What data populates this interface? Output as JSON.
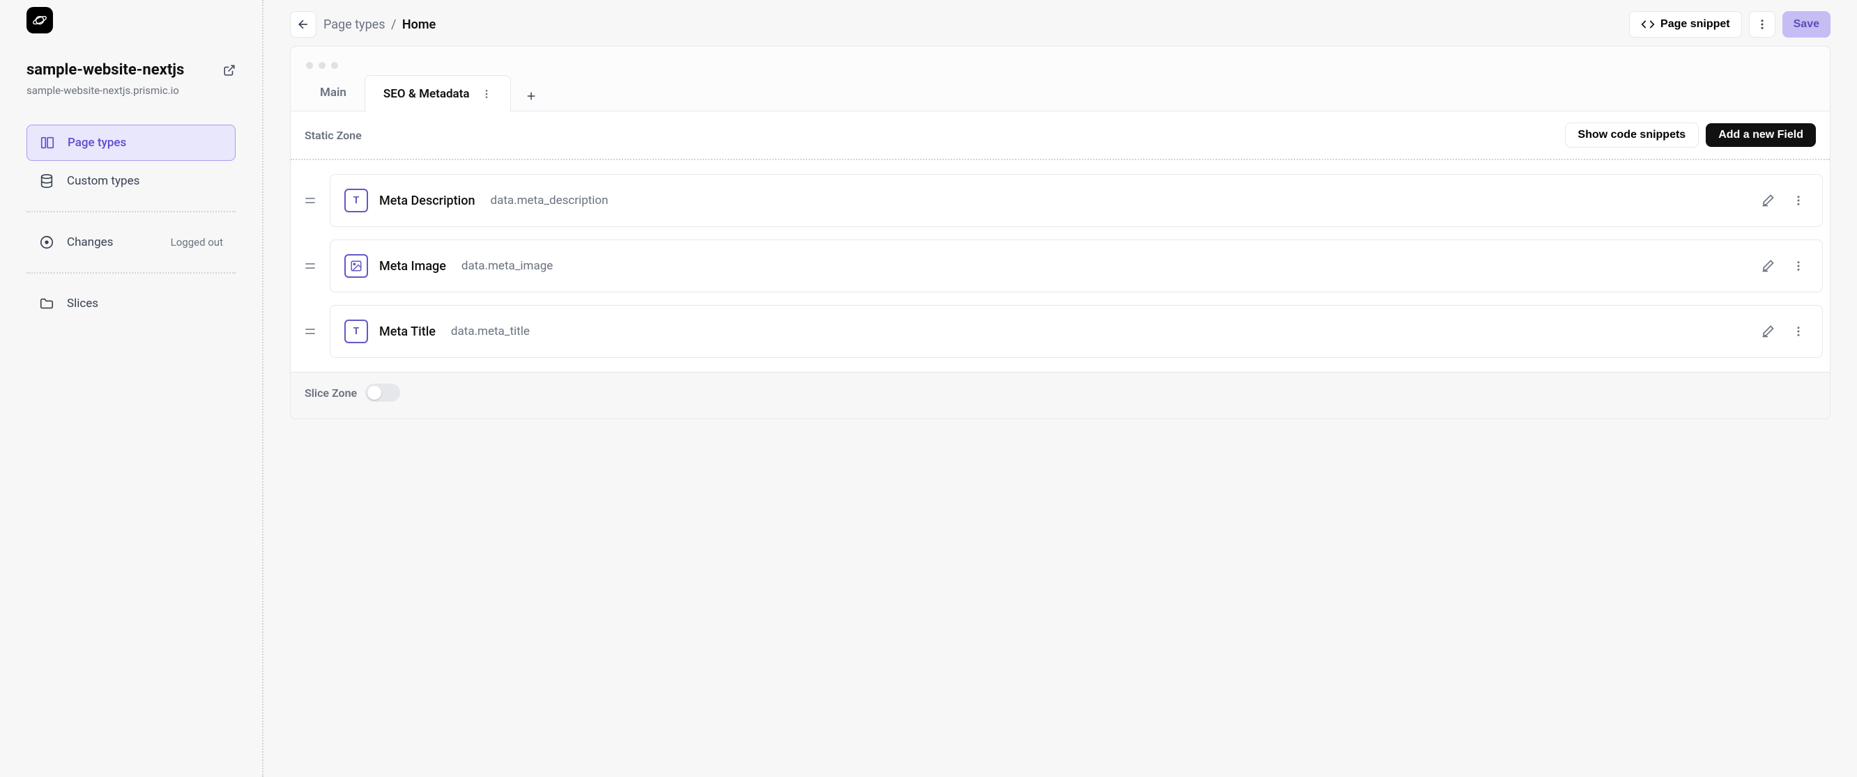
{
  "sidebar": {
    "project_name": "sample-website-nextjs",
    "project_url": "sample-website-nextjs.prismic.io",
    "nav": {
      "page_types": "Page types",
      "custom_types": "Custom types",
      "changes": "Changes",
      "changes_status": "Logged out",
      "slices": "Slices"
    }
  },
  "header": {
    "breadcrumb_parent": "Page types",
    "breadcrumb_current": "Home",
    "page_snippet": "Page snippet",
    "save": "Save"
  },
  "tabs": {
    "main": "Main",
    "seo": "SEO & Metadata"
  },
  "static_zone": {
    "title": "Static Zone",
    "show_snippets": "Show code snippets",
    "add_field": "Add a new Field",
    "fields": [
      {
        "icon": "T",
        "name": "Meta Description",
        "path": "data.meta_description",
        "type": "text"
      },
      {
        "icon": "image",
        "name": "Meta Image",
        "path": "data.meta_image",
        "type": "image"
      },
      {
        "icon": "T",
        "name": "Meta Title",
        "path": "data.meta_title",
        "type": "text"
      }
    ]
  },
  "slice_zone": {
    "title": "Slice Zone"
  }
}
